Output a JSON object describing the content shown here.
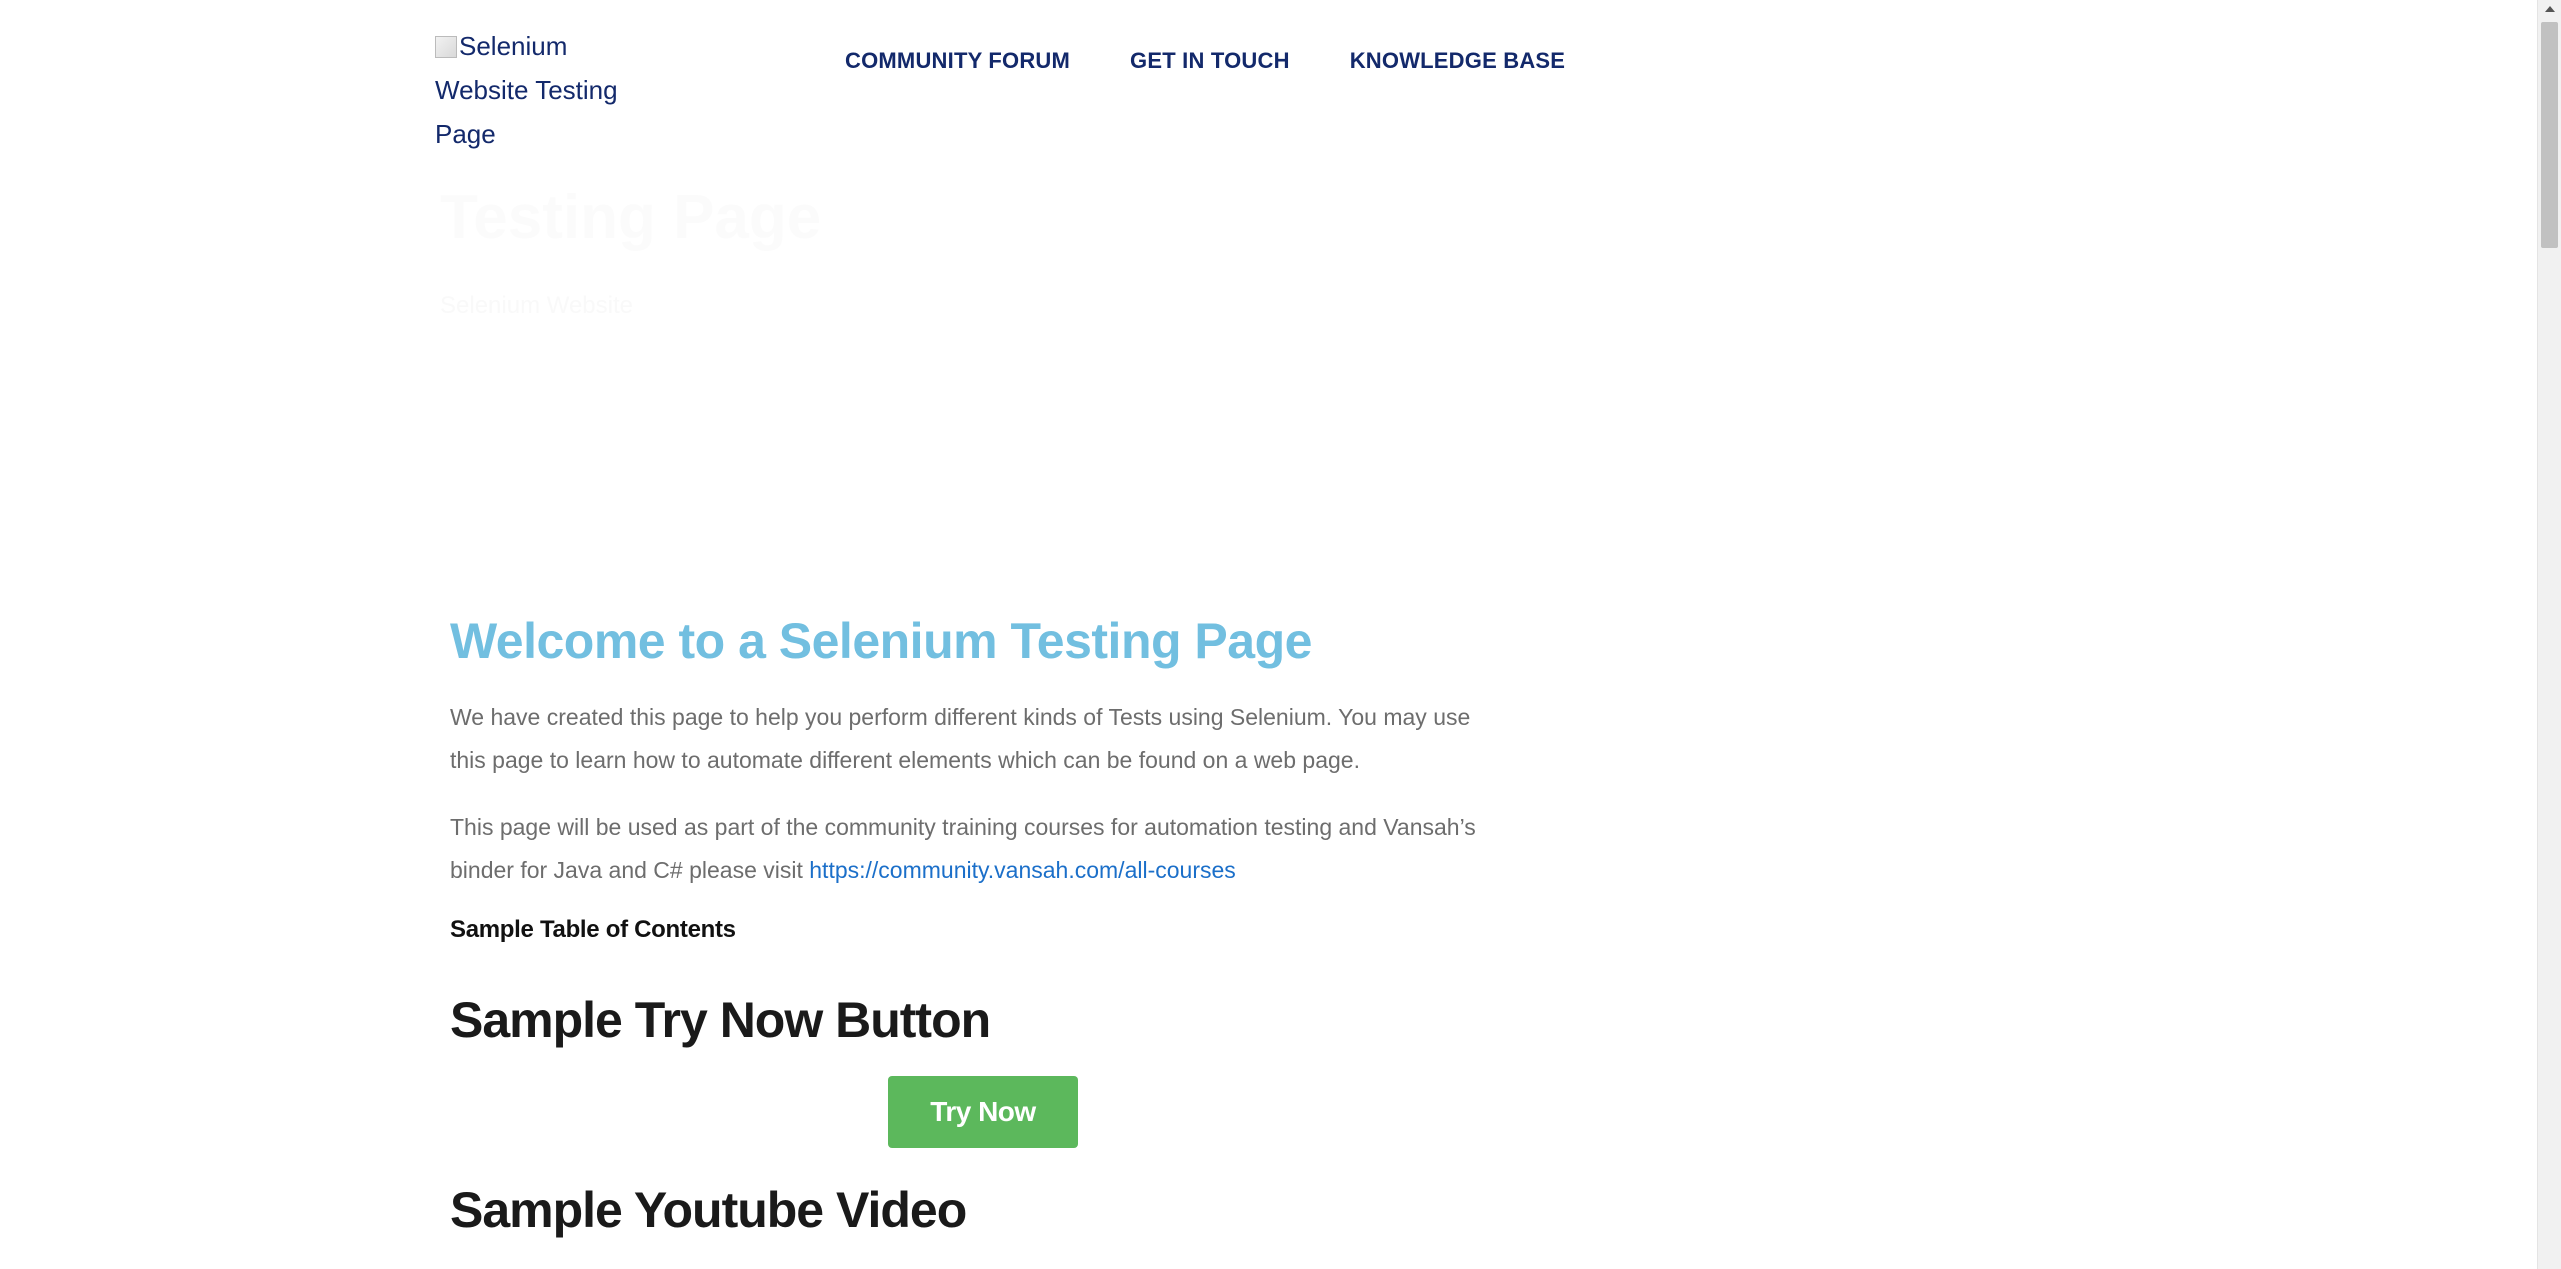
{
  "header": {
    "logo_alt": "Selenium Website Testing Page",
    "nav": [
      {
        "label": "COMMUNITY FORUM"
      },
      {
        "label": "GET IN TOUCH"
      },
      {
        "label": "KNOWLEDGE BASE"
      }
    ]
  },
  "hero": {
    "title": "Testing Page",
    "subtitle": "Selenium Website"
  },
  "main": {
    "welcome_title": "Welcome to a Selenium Testing Page",
    "para1": "We have created this page to help you perform different kinds of Tests using Selenium. You may use this page to learn how to automate different elements which can be found on a web page.",
    "para2_text": "This page will be used as part of the community training courses for automation testing and Vansah’s binder for Java and C# please visit ",
    "para2_link": "https://community.vansah.com/all-courses",
    "toc_label": "Sample Table of Contents",
    "try_heading": "Sample Try Now Button",
    "try_button": "Try Now",
    "youtube_heading": "Sample Youtube Video"
  },
  "colors": {
    "nav": "#13296b",
    "welcome": "#72bfe0",
    "link": "#1b6fc9",
    "button": "#5cb85c"
  }
}
